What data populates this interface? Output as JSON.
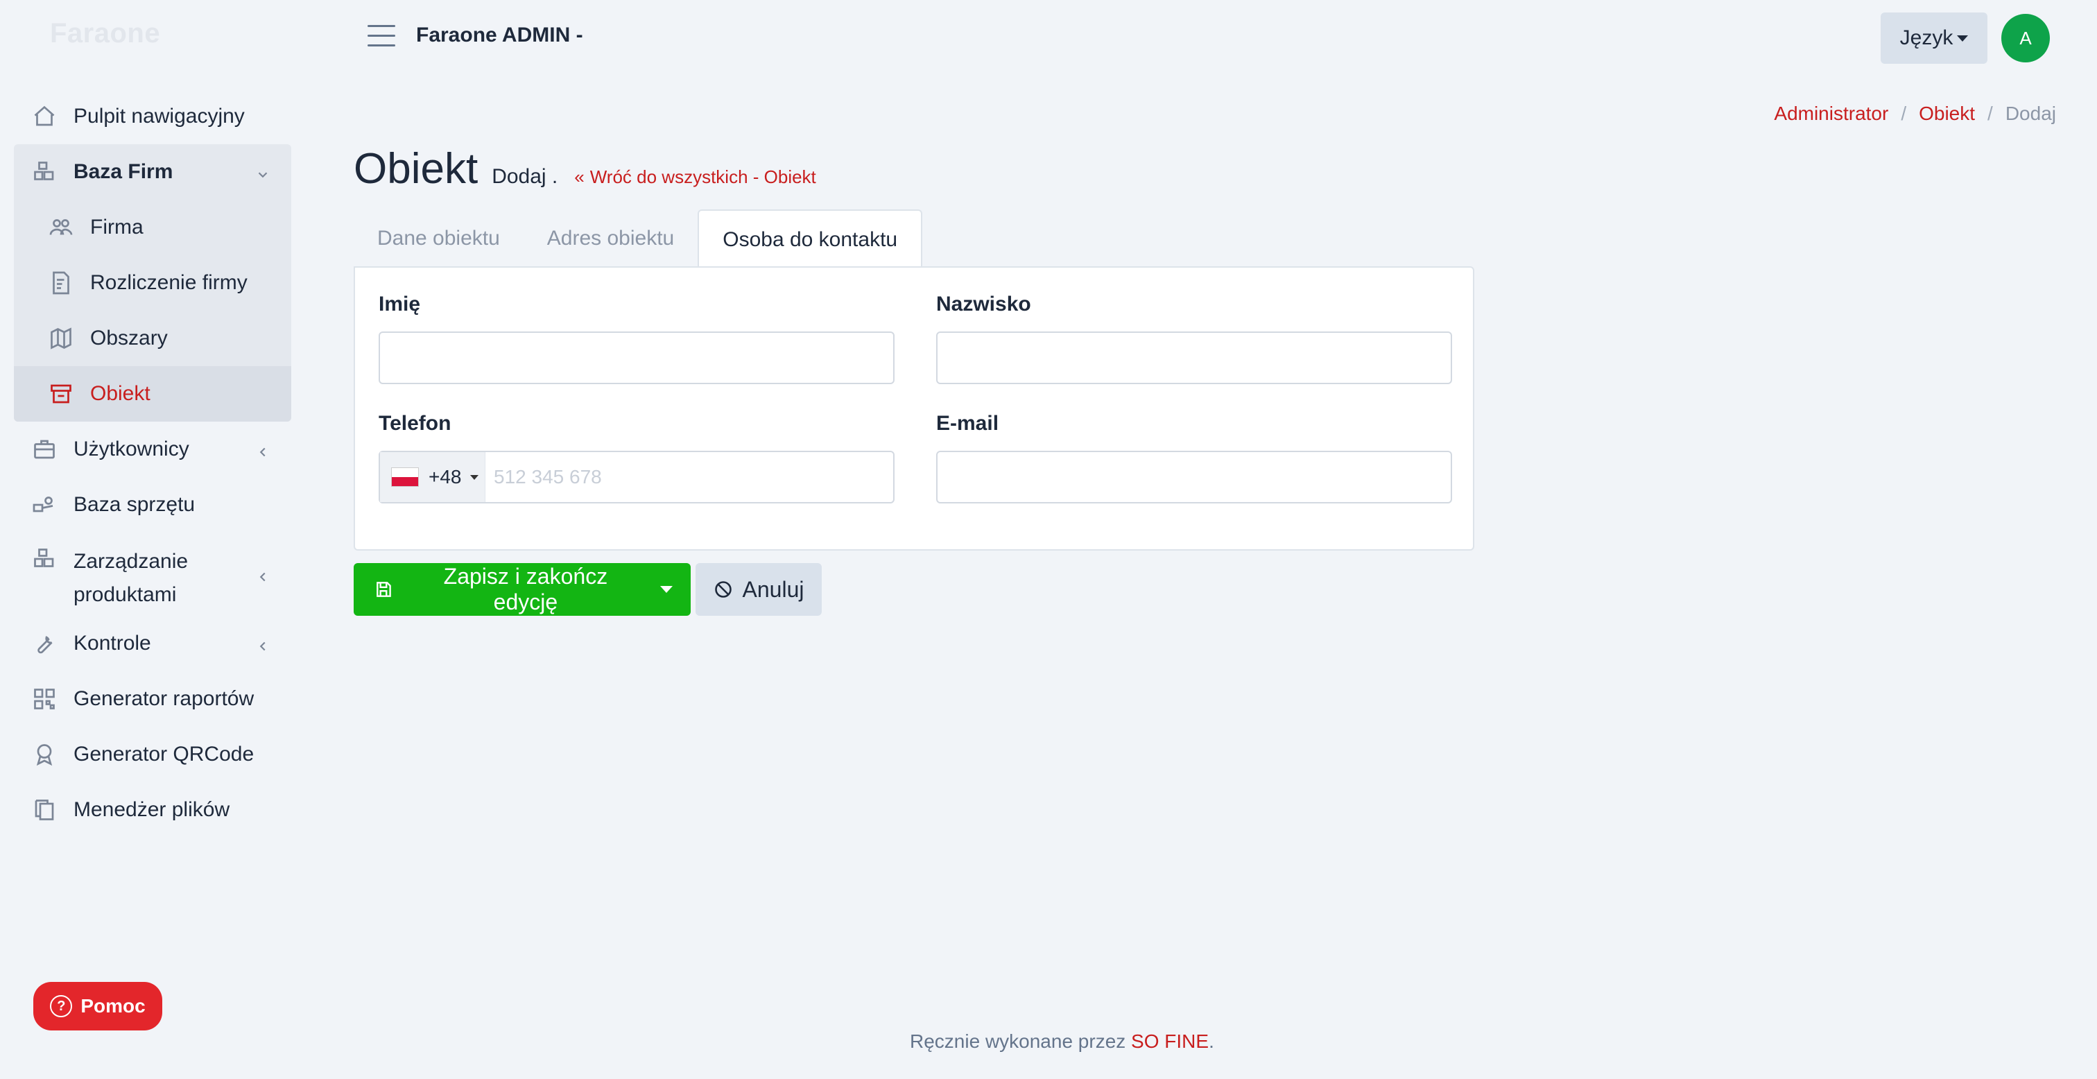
{
  "brand": "Faraone",
  "header": {
    "title": "Faraone ADMIN -",
    "language_label": "Język",
    "avatar_initial": "A"
  },
  "sidebar": {
    "items": [
      {
        "label": "Pulpit nawigacyjny",
        "icon": "home-icon"
      },
      {
        "label": "Baza Firm",
        "icon": "boxes-icon"
      },
      {
        "label": "Firma",
        "icon": "users-icon"
      },
      {
        "label": "Rozliczenie firmy",
        "icon": "invoice-icon"
      },
      {
        "label": "Obszary",
        "icon": "map-pin-icon"
      },
      {
        "label": "Obiekt",
        "icon": "building-icon"
      },
      {
        "label": "Użytkownicy",
        "icon": "briefcase-icon"
      },
      {
        "label": "Baza sprzętu",
        "icon": "equipment-icon"
      },
      {
        "label": "Zarządzanie produktami",
        "icon": "boxes-icon"
      },
      {
        "label": "Kontrole",
        "icon": "wrench-icon"
      },
      {
        "label": "Generator raportów",
        "icon": "qrcode-icon"
      },
      {
        "label": "Generator QRCode",
        "icon": "award-icon"
      },
      {
        "label": "Menedżer plików",
        "icon": "copy-icon"
      }
    ]
  },
  "breadcrumb": [
    "Administrator",
    "Obiekt",
    "Dodaj"
  ],
  "page": {
    "title": "Obiekt",
    "subtitle": "Dodaj .",
    "back_link": "Wróć do wszystkich - Obiekt"
  },
  "tabs": [
    {
      "label": "Dane obiektu",
      "active": false
    },
    {
      "label": "Adres obiektu",
      "active": false
    },
    {
      "label": "Osoba do kontaktu",
      "active": true
    }
  ],
  "form": {
    "first_name": {
      "label": "Imię",
      "value": ""
    },
    "last_name": {
      "label": "Nazwisko",
      "value": ""
    },
    "phone": {
      "label": "Telefon",
      "prefix": "+48",
      "placeholder": "512 345 678",
      "value": ""
    },
    "email": {
      "label": "E-mail",
      "value": ""
    }
  },
  "actions": {
    "save_label": "Zapisz i zakończ edycję",
    "cancel_label": "Anuluj"
  },
  "help_label": "Pomoc",
  "footer": {
    "text": "Ręcznie wykonane przez ",
    "brand": "SO FINE",
    "suffix": "."
  },
  "colors": {
    "accent": "#c81e1e",
    "save_green": "#13b513",
    "help_red": "#e3262b",
    "avatar_green": "#0ea34a"
  }
}
